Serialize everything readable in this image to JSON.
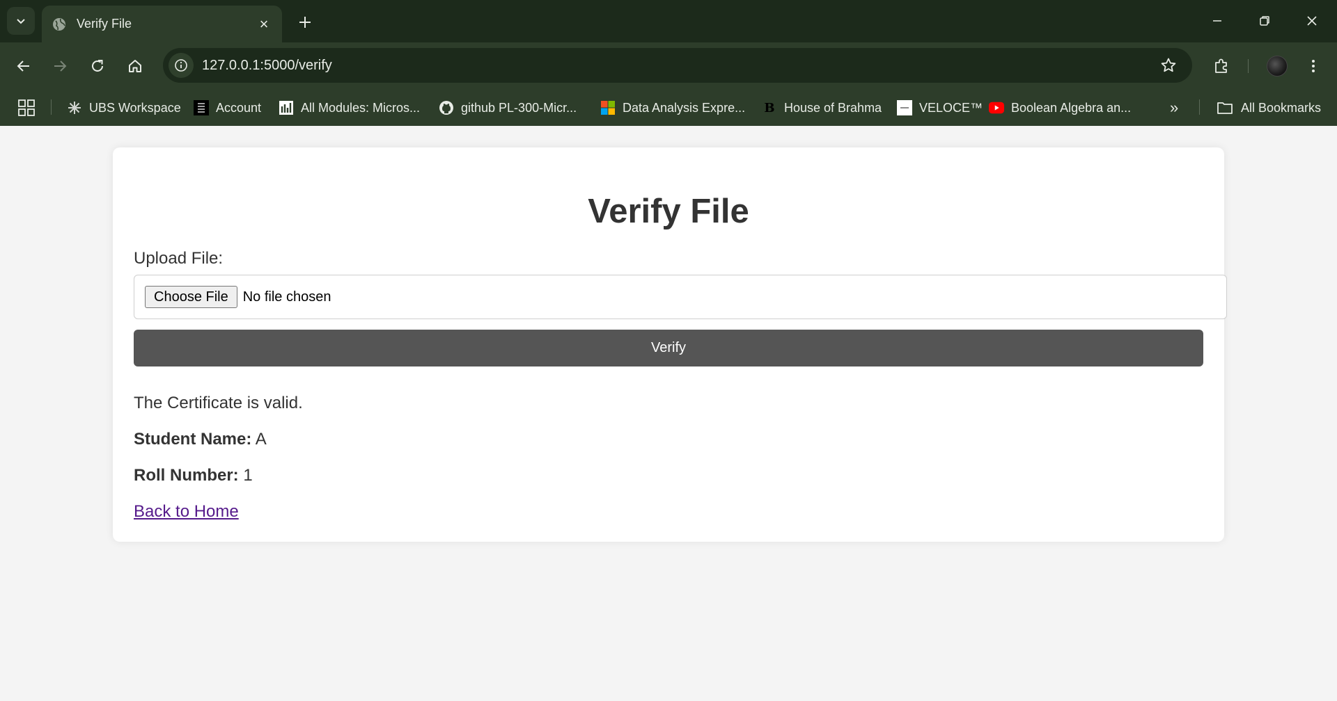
{
  "browser": {
    "tab": {
      "title": "Verify File",
      "close": "×"
    },
    "url": "127.0.0.1:5000/verify",
    "bookmarks": [
      {
        "label": "UBS Workspace",
        "icon": "ubs-icon"
      },
      {
        "label": "Account",
        "icon": "house-of-bare-icon"
      },
      {
        "label": "All Modules: Micros...",
        "icon": "microsoft-learn-icon"
      },
      {
        "label": "github PL-300-Micr...",
        "icon": "github-icon"
      },
      {
        "label": "Data Analysis Expre...",
        "icon": "microsoft-icon"
      },
      {
        "label": "House of Brahma",
        "icon": "brahma-icon"
      },
      {
        "label": "VELOCE™",
        "icon": "veloce-icon"
      },
      {
        "label": "Boolean Algebra an...",
        "icon": "youtube-icon"
      }
    ],
    "overflow": "»",
    "all_bookmarks": "All Bookmarks"
  },
  "page": {
    "title": "Verify File",
    "upload_label": "Upload File:",
    "choose_file": "Choose File",
    "no_file": "No file chosen",
    "verify_button": "Verify",
    "status": "The Certificate is valid.",
    "student_name_label": "Student Name:",
    "student_name": "A",
    "roll_number_label": "Roll Number:",
    "roll_number": "1",
    "back_link": "Back to Home"
  },
  "colors": {
    "chrome_dark": "#1c2a1b",
    "chrome_toolbar": "#2d3d2a",
    "page_bg": "#f4f4f4",
    "verify_button": "#555555",
    "link_visited": "#551a8b"
  }
}
